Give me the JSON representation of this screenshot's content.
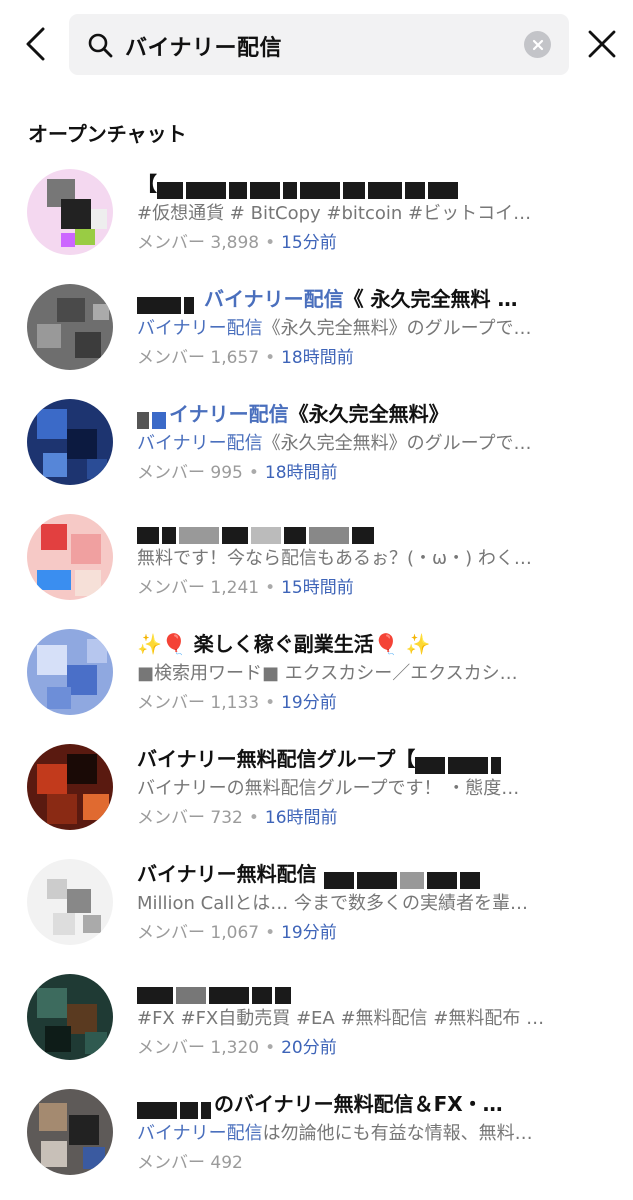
{
  "search": {
    "query": "バイナリー配信"
  },
  "section_title": "オープンチャット",
  "items": [
    {
      "name_prefix": "【",
      "name_highlight": "",
      "name_suffix": "",
      "desc_highlight": "",
      "desc": "#仮想通貨 # BitCopy #bitcoin #ビットコイ…",
      "members_label": "メンバー",
      "members": "3,898",
      "time": "15分前"
    },
    {
      "name_prefix": "",
      "name_highlight": "バイナリー配信",
      "name_suffix": "《 永久完全無料 …",
      "desc_highlight": "バイナリー配信",
      "desc": "《永久完全無料》のグループで…",
      "members_label": "メンバー",
      "members": "1,657",
      "time": "18時間前"
    },
    {
      "name_prefix": "",
      "name_highlight": "イナリー配信",
      "name_suffix": "《永久完全無料》",
      "desc_highlight": "バイナリー配信",
      "desc": "《永久完全無料》のグループで…",
      "members_label": "メンバー",
      "members": "995",
      "time": "18時間前"
    },
    {
      "name_prefix": "",
      "name_highlight": "",
      "name_suffix": "",
      "desc_highlight": "",
      "desc": "無料です！今なら配信もあるぉ？(・ω・) わく…",
      "members_label": "メンバー",
      "members": "1,241",
      "time": "15時間前"
    },
    {
      "name_prefix": "✨🎈 楽しく稼ぐ副業生活🎈 ✨",
      "name_highlight": "",
      "name_suffix": "",
      "desc_highlight": "",
      "desc": "■検索用ワード■ エクスカシー／エクスカシ…",
      "members_label": "メンバー",
      "members": "1,133",
      "time": "19分前"
    },
    {
      "name_prefix": "バイナリー無料配信グループ【",
      "name_highlight": "",
      "name_suffix": "",
      "desc_highlight": "",
      "desc": "バイナリーの無料配信グループです！ ・態度…",
      "members_label": "メンバー",
      "members": "732",
      "time": "16時間前"
    },
    {
      "name_prefix": "バイナリー無料配信",
      "name_highlight": "",
      "name_suffix": "",
      "desc_highlight": "",
      "desc": "Million Callとは… 今まで数多くの実績者を輩…",
      "members_label": "メンバー",
      "members": "1,067",
      "time": "19分前"
    },
    {
      "name_prefix": "",
      "name_highlight": "",
      "name_suffix": "",
      "desc_highlight": "",
      "desc": "#FX #FX自動売買 #EA #無料配信 #無料配布 …",
      "members_label": "メンバー",
      "members": "1,320",
      "time": "20分前"
    },
    {
      "name_prefix": "",
      "name_highlight": "",
      "name_suffix": "のバイナリー無料配信＆FX・…",
      "desc_highlight": "バイナリー配信",
      "desc": "は勿論他にも有益な情報、無料…",
      "members_label": "メンバー",
      "members": "492",
      "time": ""
    }
  ],
  "icons": {
    "back": "chevron-left-icon",
    "search": "search-icon",
    "clear": "clear-icon",
    "close": "close-icon"
  },
  "colors": {
    "highlight": "#4a6fbd",
    "time": "#3e64b8",
    "search_bg": "#f2f2f3"
  }
}
